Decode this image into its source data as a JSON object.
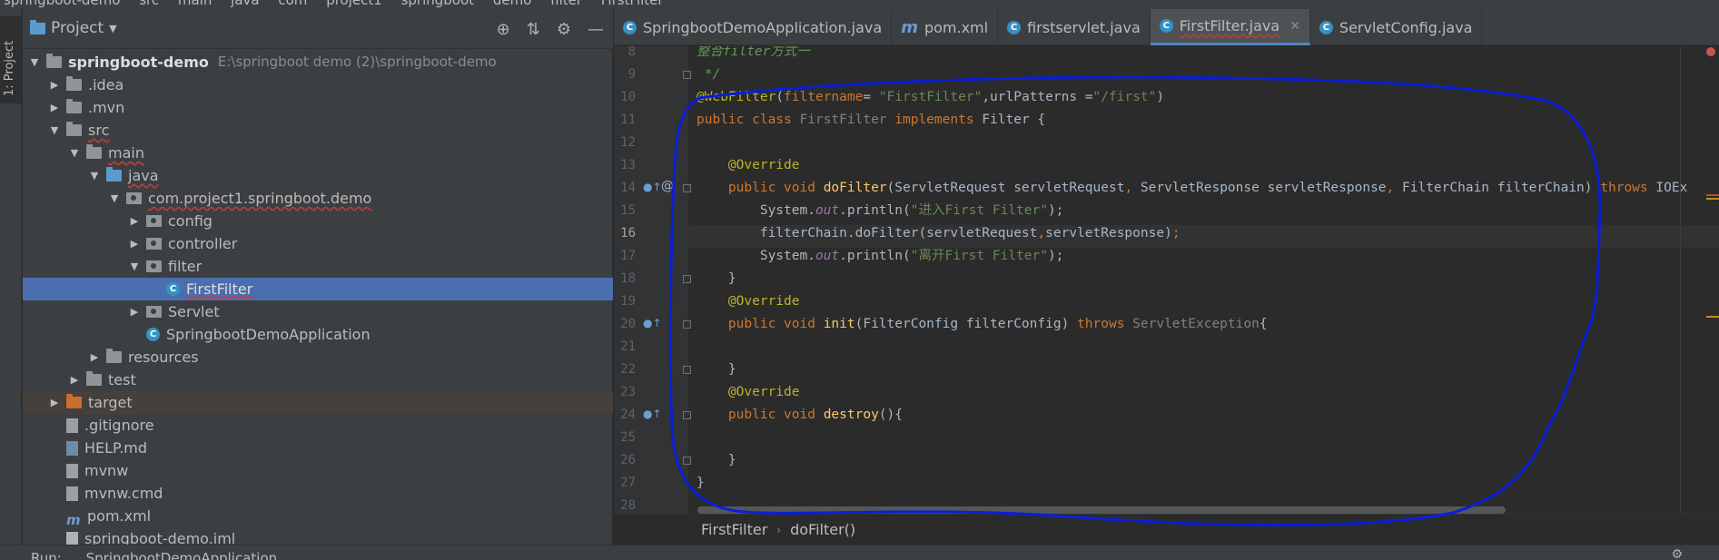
{
  "navbar": {
    "crumbs": [
      "springboot-demo",
      "src",
      "main",
      "java",
      "com",
      "project1",
      "springboot",
      "demo",
      "filter",
      "FirstFilter"
    ]
  },
  "toolstrip": {
    "project_tab": "1: Project"
  },
  "project_panel": {
    "title": "Project",
    "tree": [
      {
        "label": "springboot-demo",
        "path": "E:\\springboot demo (2)\\springboot-demo",
        "icon": "folder-icon",
        "expanded": true
      },
      {
        "label": ".idea",
        "icon": "folder-icon"
      },
      {
        "label": ".mvn",
        "icon": "folder-icon"
      },
      {
        "label": "src",
        "icon": "folder-icon",
        "expanded": true
      },
      {
        "label": "main",
        "icon": "folder-icon",
        "expanded": true
      },
      {
        "label": "java",
        "icon": "folder-icon",
        "expanded": true
      },
      {
        "label": "com.project1.springboot.demo",
        "icon": "package-icon",
        "expanded": true
      },
      {
        "label": "config",
        "icon": "package-icon"
      },
      {
        "label": "controller",
        "icon": "package-icon"
      },
      {
        "label": "filter",
        "icon": "package-icon",
        "expanded": true
      },
      {
        "label": "FirstFilter",
        "icon": "class-icon",
        "selected": true
      },
      {
        "label": "Servlet",
        "icon": "package-icon"
      },
      {
        "label": "SpringbootDemoApplication",
        "icon": "class-icon"
      },
      {
        "label": "resources",
        "icon": "folder-icon"
      },
      {
        "label": "test",
        "icon": "folder-icon"
      },
      {
        "label": "target",
        "icon": "folder-icon"
      },
      {
        "label": ".gitignore",
        "icon": "file-icon"
      },
      {
        "label": "HELP.md",
        "icon": "markdown-file-icon"
      },
      {
        "label": "mvnw",
        "icon": "file-icon"
      },
      {
        "label": "mvnw.cmd",
        "icon": "file-icon"
      },
      {
        "label": "pom.xml",
        "icon": "maven-icon"
      },
      {
        "label": "springboot-demo.iml",
        "icon": "file-icon"
      }
    ]
  },
  "tabs": [
    {
      "label": "SpringbootDemoApplication.java",
      "icon": "class-icon"
    },
    {
      "label": "pom.xml",
      "icon": "maven-icon"
    },
    {
      "label": "firstservlet.java",
      "icon": "class-icon"
    },
    {
      "label": "FirstFilter.java",
      "icon": "class-icon",
      "active": true
    },
    {
      "label": "ServletConfig.java",
      "icon": "class-icon"
    }
  ],
  "editor": {
    "line_numbers": [
      "8",
      "9",
      "10",
      "11",
      "12",
      "13",
      "14",
      "15",
      "16",
      "17",
      "18",
      "19",
      "20",
      "21",
      "22",
      "23",
      "24",
      "25",
      "26",
      "27",
      "28"
    ],
    "code": {
      "l8": "整合filter方式一",
      "l9": " */",
      "l10_ann": "@WebFilter",
      "l10_p1": "filtername",
      "l10_eq": "= ",
      "l10_s1": "\"FirstFilter\"",
      "l10_c": ",urlPatterns =",
      "l10_s2": "\"/first\"",
      "l10_end": ")",
      "l11_kw1": "public class ",
      "l11_cls": "FirstFilter ",
      "l11_kw2": "implements ",
      "l11_rest": "Filter {",
      "l13": "@Override",
      "l14_kw": "public void ",
      "l14_fn": "doFilter",
      "l14_args1": "(ServletRequest servletRequest",
      "l14_comma1": ", ",
      "l14_args2": "ServletResponse servletResponse",
      "l14_comma2": ", ",
      "l14_args3": "FilterChain filterChain) ",
      "l14_throws": "throws ",
      "l14_exc": "IOEx",
      "l15_a": "System.",
      "l15_f": "out",
      "l15_b": ".println(",
      "l15_s": "\"进入First Filter\"",
      "l15_c": ");",
      "l16_a": "filterChain.doFilter(servletRequest",
      "l16_comma": ",",
      "l16_b": "servletResponse)",
      "l16_semi": ";",
      "l17_a": "System.",
      "l17_f": "out",
      "l17_b": ".println(",
      "l17_s": "\"离开First Filter\"",
      "l17_c": ");",
      "l18": "}",
      "l19": "@Override",
      "l20_kw": "public void ",
      "l20_fn": "init",
      "l20_args": "(FilterConfig filterConfig) ",
      "l20_throws": "throws ",
      "l20_exc": "ServletException",
      "l20_end": "{",
      "l22": "}",
      "l23": "@Override",
      "l24_kw": "public void ",
      "l24_fn": "destroy",
      "l24_end": "(){",
      "l26": "}",
      "l27": "}"
    }
  },
  "editor_breadcrumb": {
    "class": "FirstFilter",
    "method": "doFilter()"
  },
  "runbar": {
    "tool": "Run:",
    "config": "SpringbootDemoApplication"
  },
  "colors": {
    "selection": "#4b6eaf",
    "annotation_stroke": "#0a1fd6",
    "keyword": "#cc7832",
    "string": "#6a8759",
    "annotation": "#bbb529"
  }
}
